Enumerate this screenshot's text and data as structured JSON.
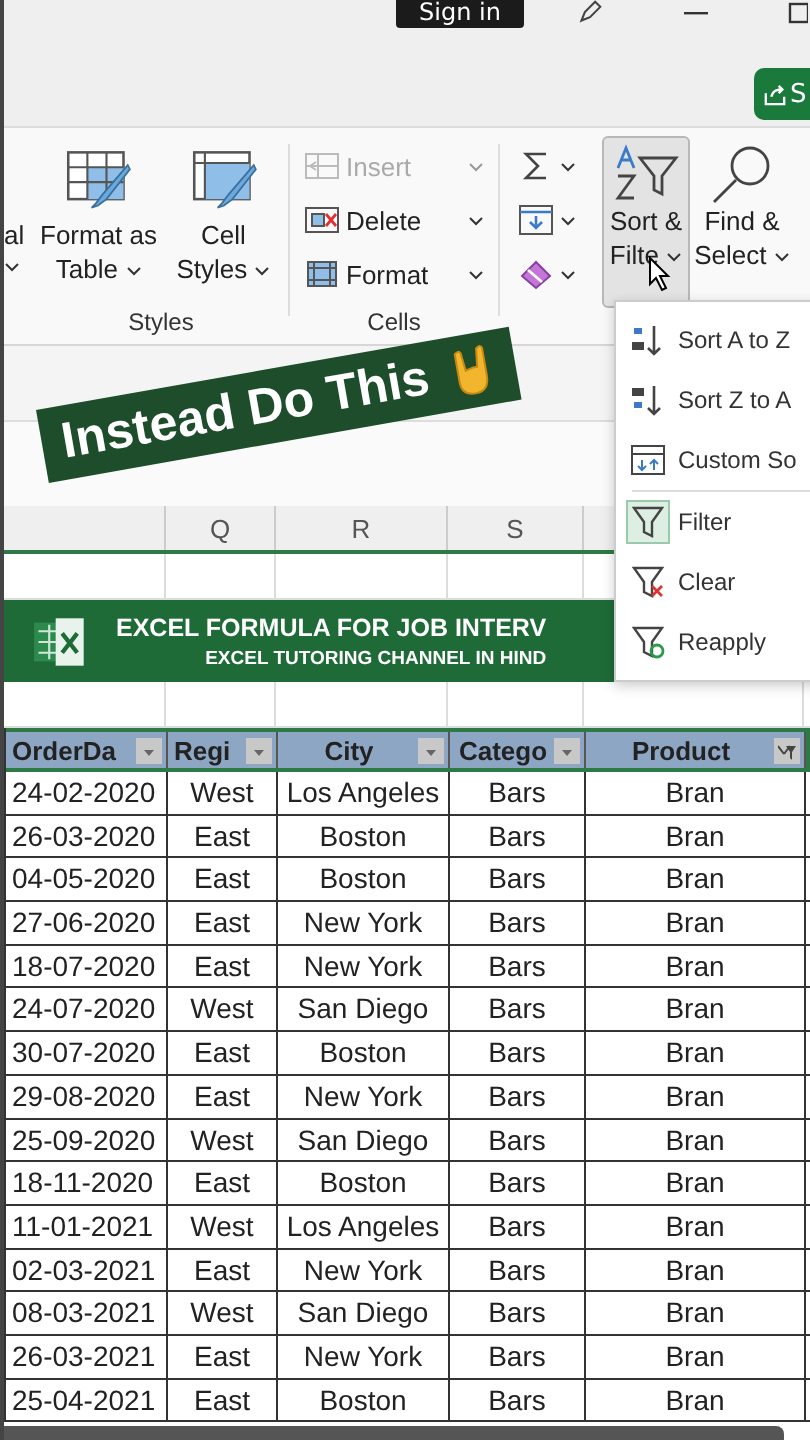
{
  "title_bar": {
    "sign_in": "Sign in",
    "share_button": "S"
  },
  "ribbon": {
    "partial_label": "al",
    "styles": {
      "label": "Styles",
      "buttons": [
        {
          "label": "Format as Table",
          "kind": "table"
        },
        {
          "label": "Cell Styles",
          "kind": "styles"
        }
      ]
    },
    "cells": {
      "label": "Cells",
      "buttons": [
        {
          "label": "Insert",
          "kind": "insert",
          "disabled": true
        },
        {
          "label": "Delete",
          "kind": "delete",
          "disabled": false
        },
        {
          "label": "Format",
          "kind": "format",
          "disabled": false
        }
      ]
    },
    "editing": {
      "small": [
        {
          "kind": "sum"
        },
        {
          "kind": "fill"
        },
        {
          "kind": "clear"
        }
      ],
      "big": [
        {
          "label_1": "Sort &",
          "label_2": "Filte",
          "kind": "sort",
          "selected": true
        },
        {
          "label_1": "Find &",
          "label_2": "Select",
          "kind": "find",
          "selected": false
        }
      ]
    }
  },
  "overlay_banner": {
    "text": "Instead Do This"
  },
  "column_letters": [
    "Q",
    "R",
    "S"
  ],
  "sheet_banner": {
    "title": "EXCEL FORMULA FOR JOB INTERV",
    "subtitle": "EXCEL TUTORING CHANNEL IN HIND"
  },
  "table": {
    "columns": [
      {
        "label": "OrderDa",
        "filtered": false
      },
      {
        "label": "Regi",
        "filtered": false
      },
      {
        "label": "City",
        "filtered": false
      },
      {
        "label": "Catego",
        "filtered": false
      },
      {
        "label": "Product",
        "filtered": true
      }
    ],
    "rows": [
      [
        "24-02-2020",
        "West",
        "Los Angeles",
        "Bars",
        "Bran"
      ],
      [
        "26-03-2020",
        "East",
        "Boston",
        "Bars",
        "Bran"
      ],
      [
        "04-05-2020",
        "East",
        "Boston",
        "Bars",
        "Bran"
      ],
      [
        "27-06-2020",
        "East",
        "New York",
        "Bars",
        "Bran"
      ],
      [
        "18-07-2020",
        "East",
        "New York",
        "Bars",
        "Bran"
      ],
      [
        "24-07-2020",
        "West",
        "San Diego",
        "Bars",
        "Bran"
      ],
      [
        "30-07-2020",
        "East",
        "Boston",
        "Bars",
        "Bran"
      ],
      [
        "29-08-2020",
        "East",
        "New York",
        "Bars",
        "Bran"
      ],
      [
        "25-09-2020",
        "West",
        "San Diego",
        "Bars",
        "Bran"
      ],
      [
        "18-11-2020",
        "East",
        "Boston",
        "Bars",
        "Bran"
      ],
      [
        "11-01-2021",
        "West",
        "Los Angeles",
        "Bars",
        "Bran"
      ],
      [
        "02-03-2021",
        "East",
        "New York",
        "Bars",
        "Bran"
      ],
      [
        "08-03-2021",
        "West",
        "San Diego",
        "Bars",
        "Bran"
      ],
      [
        "26-03-2021",
        "East",
        "New York",
        "Bars",
        "Bran"
      ],
      [
        "25-04-2021",
        "East",
        "Boston",
        "Bars",
        "Bran"
      ]
    ]
  },
  "sort_menu": {
    "items": [
      {
        "label": "Sort A to Z",
        "kind": "asc",
        "on": false
      },
      {
        "label": "Sort Z to A",
        "kind": "desc",
        "on": false
      },
      {
        "label": "Custom So",
        "kind": "custom",
        "on": false
      },
      {
        "label": "Filter",
        "kind": "filter",
        "on": true
      },
      {
        "label": "Clear",
        "kind": "clear",
        "on": false
      },
      {
        "label": "Reapply",
        "kind": "reapply",
        "on": false
      }
    ]
  }
}
